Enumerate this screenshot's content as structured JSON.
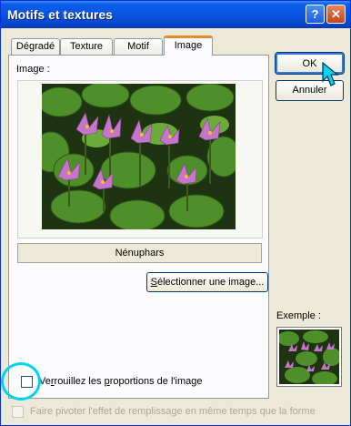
{
  "window": {
    "title": "Motifs et textures",
    "help_button": "?",
    "close_button": "✕"
  },
  "tabs": [
    {
      "label": "Dégradé",
      "active": false
    },
    {
      "label": "Texture",
      "active": false
    },
    {
      "label": "Motif",
      "active": false
    },
    {
      "label": "Image",
      "active": true
    }
  ],
  "panel": {
    "image_label": "Image :",
    "image_name": "Nénuphars",
    "select_button": "Sélectionner une image...",
    "lock_ratio": {
      "label": "Verrouillez les proportions de l'image",
      "checked": false
    }
  },
  "buttons": {
    "ok": "OK",
    "cancel": "Annuler"
  },
  "preview": {
    "label": "Exemple :"
  },
  "rotate_fill": {
    "label": "Faire pivoter l'effet de remplissage en même temps que la forme",
    "checked": false,
    "enabled": false
  },
  "colors": {
    "title_bar": "#0a53e0",
    "dialog_bg": "#ece9d8",
    "annotation": "#00d3ee"
  }
}
